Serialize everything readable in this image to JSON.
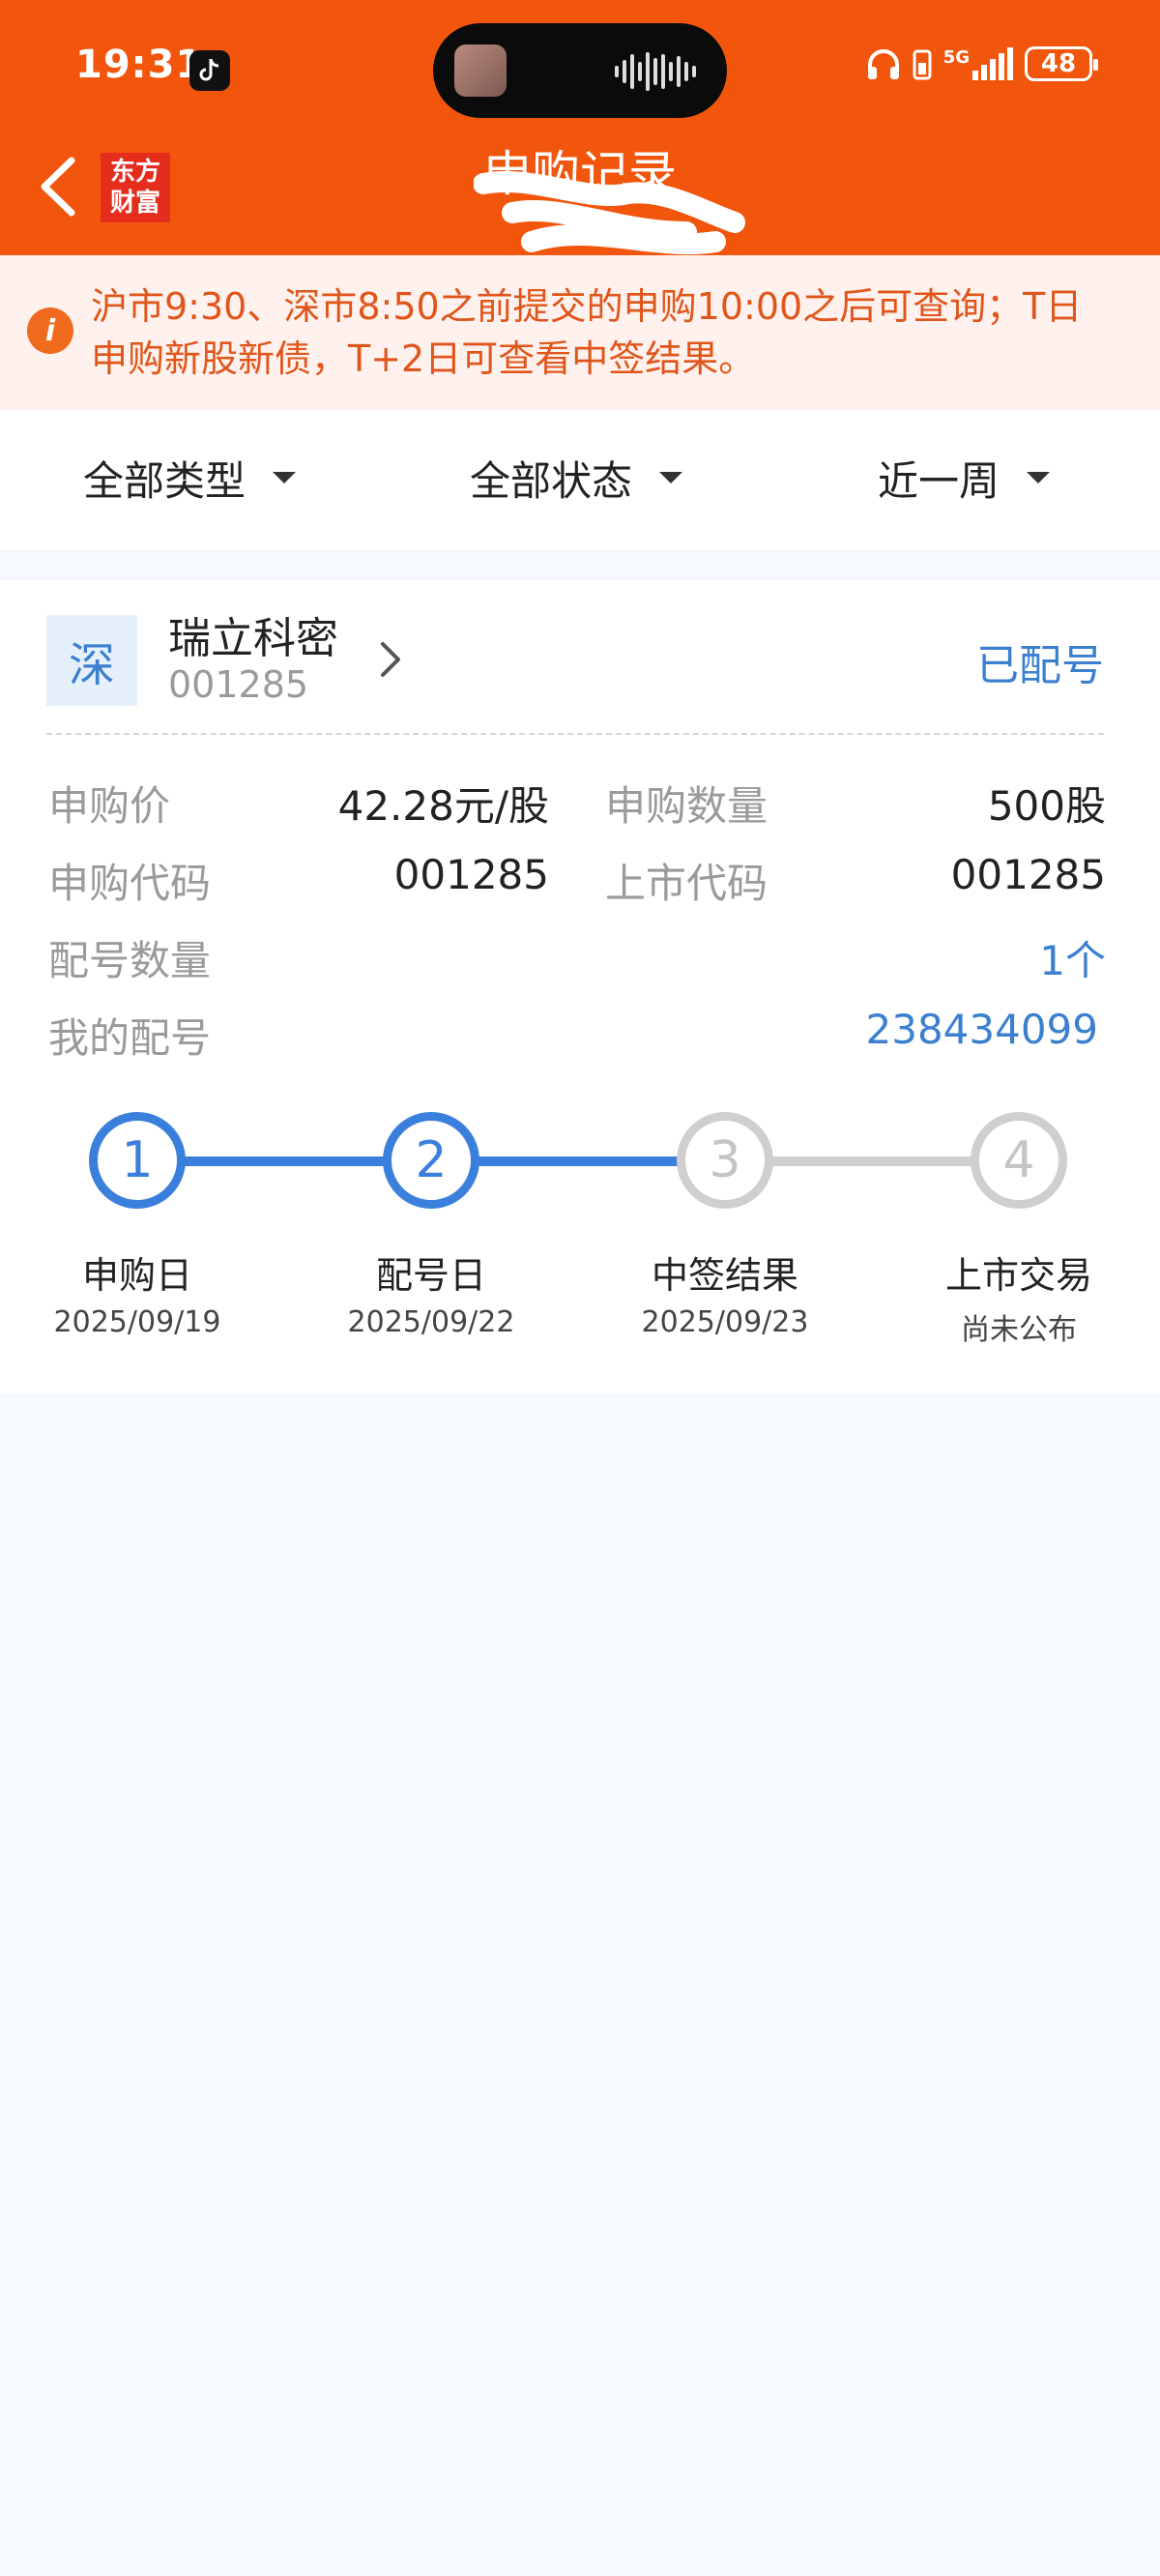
{
  "status_bar": {
    "time": "19:31",
    "battery": "48",
    "network": "5G"
  },
  "header": {
    "title": "申购记录",
    "logo_line1": "东方",
    "logo_line2": "财富"
  },
  "notice": {
    "text": "沪市9:30、深市8:50之前提交的申购10:00之后可查询；T日申购新股新债，T+2日可查看中签结果。",
    "icon": "i"
  },
  "filters": [
    {
      "label": "全部类型"
    },
    {
      "label": "全部状态"
    },
    {
      "label": "近一周"
    }
  ],
  "record": {
    "market": "深",
    "name": "瑞立科密",
    "code": "001285",
    "status": "已配号",
    "fields": {
      "price_label": "申购价",
      "price_value": "42.28元/股",
      "qty_label": "申购数量",
      "qty_value": "500股",
      "sub_code_label": "申购代码",
      "sub_code_value": "001285",
      "list_code_label": "上市代码",
      "list_code_value": "001285",
      "alloc_count_label": "配号数量",
      "alloc_count_value": "1个",
      "my_alloc_label": "我的配号",
      "my_alloc_value": "238434099"
    },
    "steps": [
      {
        "num": "1",
        "label": "申购日",
        "date": "2025/09/19",
        "done": true
      },
      {
        "num": "2",
        "label": "配号日",
        "date": "2025/09/22",
        "done": true
      },
      {
        "num": "3",
        "label": "中签结果",
        "date": "2025/09/23",
        "done": false
      },
      {
        "num": "4",
        "label": "上市交易",
        "date": "尚未公布",
        "done": false
      }
    ]
  },
  "colors": {
    "brand": "#f2550c",
    "accent_blue": "#3b7fdd",
    "notice_text": "#e0561a"
  }
}
